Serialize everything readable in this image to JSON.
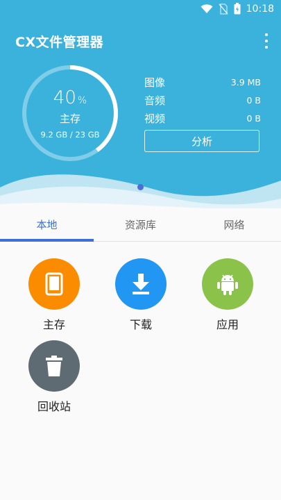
{
  "status": {
    "time": "10:18"
  },
  "app": {
    "title": "CX文件管理器"
  },
  "storage": {
    "percent": "40",
    "percent_sign": "%",
    "percent_value": 0.4,
    "name": "主存",
    "usage": "9.2 GB / 23 GB"
  },
  "stats": [
    {
      "label": "图像",
      "value": "3.9 MB"
    },
    {
      "label": "音频",
      "value": "0 B"
    },
    {
      "label": "视频",
      "value": "0 B"
    }
  ],
  "analyze_label": "分析",
  "tabs": [
    {
      "label": "本地",
      "active": true
    },
    {
      "label": "资源库",
      "active": false
    },
    {
      "label": "网络",
      "active": false
    }
  ],
  "items": [
    {
      "label": "主存",
      "icon": "tablet-icon",
      "color": "#fb8c00"
    },
    {
      "label": "下载",
      "icon": "download-icon",
      "color": "#2196f3"
    },
    {
      "label": "应用",
      "icon": "android-icon",
      "color": "#8bc34a"
    },
    {
      "label": "回收站",
      "icon": "trash-icon",
      "color": "#5f6b73"
    }
  ]
}
